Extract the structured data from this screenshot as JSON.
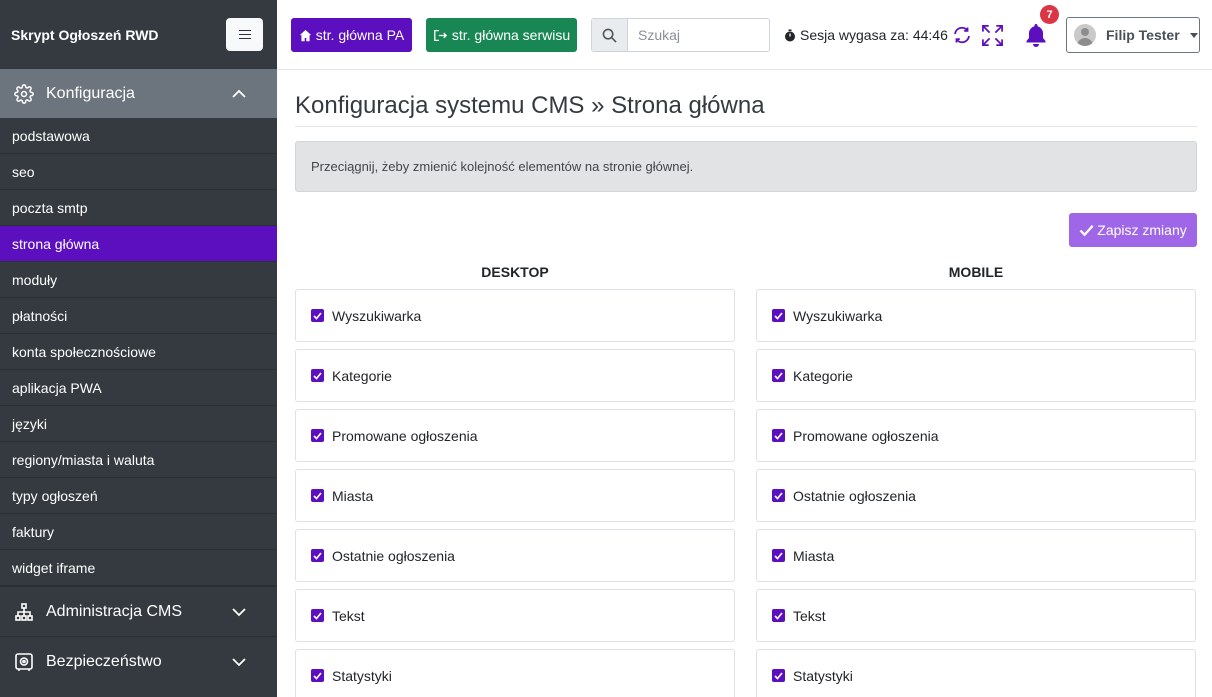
{
  "sidebar": {
    "brand": "Skrypt Ogłoszeń RWD",
    "sections": [
      {
        "label": "Konfiguracja",
        "icon": "gear-icon"
      },
      {
        "label": "Administracja CMS",
        "icon": "sitemap-icon"
      },
      {
        "label": "Bezpieczeństwo",
        "icon": "vault-icon"
      }
    ],
    "items": [
      {
        "label": "podstawowa"
      },
      {
        "label": "seo"
      },
      {
        "label": "poczta smtp"
      },
      {
        "label": "strona główna"
      },
      {
        "label": "moduły"
      },
      {
        "label": "płatności"
      },
      {
        "label": "konta społecznościowe"
      },
      {
        "label": "aplikacja PWA"
      },
      {
        "label": "języki"
      },
      {
        "label": "regiony/miasta i waluta"
      },
      {
        "label": "typy ogłoszeń"
      },
      {
        "label": "faktury"
      },
      {
        "label": "widget iframe"
      }
    ],
    "active_item": "strona główna"
  },
  "topbar": {
    "btn_home_pa": "str. główna PA",
    "btn_home_site": "str. główna serwisu",
    "search_placeholder": "Szukaj",
    "session_text": "Sesja wygasa za: 44:46",
    "notifications_count": "7",
    "user_name": "Filip Tester"
  },
  "main": {
    "title": "Konfiguracja systemu CMS » Strona główna",
    "alert": "Przeciągnij, żeby zmienić kolejność elementów na stronie głównej.",
    "save_label": "Zapisz zmiany",
    "desktop_header": "DESKTOP",
    "mobile_header": "MOBILE",
    "desktop_items": [
      {
        "label": "Wyszukiwarka",
        "checked": true
      },
      {
        "label": "Kategorie",
        "checked": true
      },
      {
        "label": "Promowane ogłoszenia",
        "checked": true
      },
      {
        "label": "Miasta",
        "checked": true
      },
      {
        "label": "Ostatnie ogłoszenia",
        "checked": true
      },
      {
        "label": "Tekst",
        "checked": true
      },
      {
        "label": "Statystyki",
        "checked": true
      }
    ],
    "mobile_items": [
      {
        "label": "Wyszukiwarka",
        "checked": true
      },
      {
        "label": "Kategorie",
        "checked": true
      },
      {
        "label": "Promowane ogłoszenia",
        "checked": true
      },
      {
        "label": "Ostatnie ogłoszenia",
        "checked": true
      },
      {
        "label": "Miasta",
        "checked": true
      },
      {
        "label": "Tekst",
        "checked": true
      },
      {
        "label": "Statystyki",
        "checked": true
      }
    ]
  },
  "colors": {
    "sidebar_bg": "#343a40",
    "accent_purple": "#5b0fbf",
    "success_green": "#198754",
    "save_button": "#9f67e8",
    "badge_red": "#dc3545"
  }
}
